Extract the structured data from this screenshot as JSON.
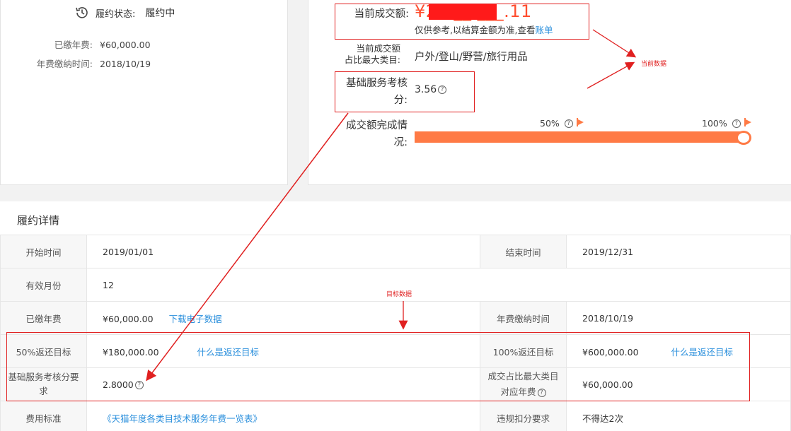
{
  "left_card": {
    "status_label": "履约状态:",
    "status_value": "履约中",
    "paid_fee_label": "已缴年费:",
    "paid_fee_value": "¥60,000.00",
    "paid_time_label": "年费缴纳时间:",
    "paid_time_value": "2018/10/19"
  },
  "right_card": {
    "current_amount_label": "当前成交额:",
    "current_amount_value": "¥2,2__,___.11",
    "note_text": "仅供参考,以结算金额为准,查看",
    "note_link": "账单",
    "top_category_label_line1": "当前成交额",
    "top_category_label_line2": "占比最大类目:",
    "top_category_value": "户外/登山/野营/旅行用品",
    "score_label_line1": "基础服务考核",
    "score_label_line2": "分:",
    "score_value": "3.56",
    "completion_label_line1": "成交额完成情",
    "completion_label_line2": "况:",
    "progress_percent": 100,
    "flag_50_label": "50%",
    "flag_100_label": "100%"
  },
  "annotations": {
    "current_data": "当前数据",
    "target_data": "目标数据",
    "color": "#e02020"
  },
  "detail": {
    "title": "履约详情",
    "rows": [
      {
        "l1": "开始时间",
        "v1": "2019/01/01",
        "l2": "结束时间",
        "v2": "2019/12/31"
      },
      {
        "l1": "有效月份",
        "v1": "12"
      },
      {
        "l1": "已缴年费",
        "v1": "¥60,000.00",
        "v1_link": "下载电子数据",
        "l2": "年费缴纳时间",
        "v2": "2018/10/19"
      },
      {
        "l1": "50%返还目标",
        "v1": "¥180,000.00",
        "v1_link": "什么是返还目标",
        "l2": "100%返还目标",
        "v2": "¥600,000.00",
        "v2_link": "什么是返还目标"
      },
      {
        "l1_line1": "基础服务考核分要",
        "l1_line2": "求",
        "v1": "2.8000",
        "l2_line1": "成交占比最大类目",
        "l2_line2": "对应年费",
        "v2": "¥60,000.00"
      },
      {
        "l1": "费用标准",
        "v1_link": "《天猫年度各类目技术服务年费一览表》",
        "l2": "违规扣分要求",
        "v2": "不得达2次"
      }
    ]
  },
  "colors": {
    "accent_orange": "#ff7a45",
    "amount_red": "#ff4d2e",
    "link_blue": "#2a8fdc"
  }
}
